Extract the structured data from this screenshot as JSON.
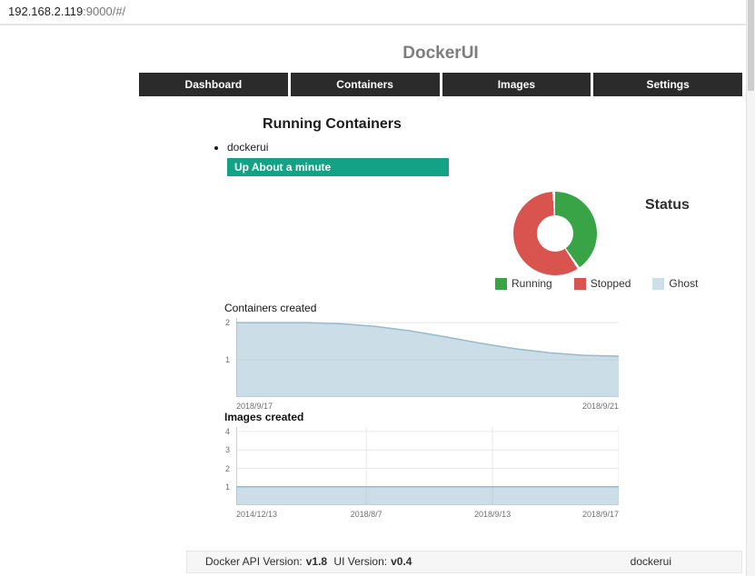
{
  "browser": {
    "url_host": "192.168.2.119",
    "url_rest": ":9000/#/"
  },
  "header": {
    "title": "DockerUI"
  },
  "nav": {
    "items": [
      {
        "label": "Dashboard"
      },
      {
        "label": "Containers"
      },
      {
        "label": "Images"
      },
      {
        "label": "Settings"
      }
    ]
  },
  "running": {
    "title": "Running Containers",
    "containers": [
      {
        "name": "dockerui",
        "status": "Up About a minute"
      }
    ],
    "status_color": "#13a285"
  },
  "chart_data": [
    {
      "type": "pie",
      "title": "Status",
      "donut": true,
      "legend_position": "bottom",
      "segments": [
        {
          "label": "Running",
          "percent": 41,
          "color": "#38a445"
        },
        {
          "label": "Stopped",
          "percent": 59,
          "color": "#d9534f"
        },
        {
          "label": "Ghost",
          "percent": 0,
          "color": "#cde0e9"
        }
      ]
    },
    {
      "type": "area",
      "title": "Containers created",
      "x_ticks": [
        {
          "label": "2018/9/17",
          "pos": 0
        },
        {
          "label": "2018/9/21",
          "pos": 100
        }
      ],
      "y_ticks": [
        1,
        2
      ],
      "ylim": [
        0,
        2
      ],
      "values": [
        2,
        2,
        2,
        1.97,
        1.9,
        1.78,
        1.62,
        1.45,
        1.3,
        1.19,
        1.12,
        1.1
      ],
      "fill": "rgba(151,187,205,0.5)",
      "line": "rgba(151,187,205,1)",
      "grid": true
    },
    {
      "type": "area",
      "title": "Images created",
      "x_ticks": [
        {
          "label": "2014/12/13",
          "pos": 0
        },
        {
          "label": "2018/8/7",
          "pos": 34,
          "grid": true
        },
        {
          "label": "2018/9/13",
          "pos": 67,
          "grid": true
        },
        {
          "label": "2018/9/17",
          "pos": 100,
          "grid": true
        }
      ],
      "y_ticks": [
        1,
        2,
        3,
        4
      ],
      "ylim": [
        0,
        4
      ],
      "values": [
        1,
        1,
        1,
        1,
        1,
        1,
        1,
        1,
        1,
        1,
        1,
        1
      ],
      "fill": "rgba(151,187,205,0.5)",
      "line": "rgba(151,187,205,1)",
      "grid": true
    }
  ],
  "footer": {
    "api_label": "Docker API Version:",
    "api_version": "v1.8",
    "ui_label": "UI Version:",
    "ui_version": "v0.4",
    "brand": "dockerui"
  }
}
